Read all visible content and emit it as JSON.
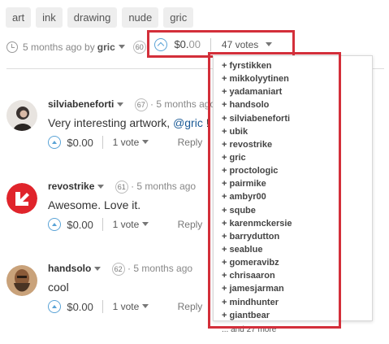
{
  "tags": [
    "art",
    "ink",
    "drawing",
    "nude",
    "gric"
  ],
  "post_meta": {
    "time": "5 months ago by",
    "author": "gric",
    "reputation": "60",
    "payout_main": "$0.",
    "payout_cents": "00",
    "votes": "47 votes"
  },
  "voters": {
    "items": [
      "+ fyrstikken",
      "+ mikkolyytinen",
      "+ yadamaniart",
      "+ handsolo",
      "+ silviabeneforti",
      "+ ubik",
      "+ revostrike",
      "+ gric",
      "+ proctologic",
      "+ pairmike",
      "+ ambyr00",
      "+ sqube",
      "+ karenmckersie",
      "+ barrydutton",
      "+ seablue",
      "+ gomeravibz",
      "+ chrisaaron",
      "+ jamesjarman",
      "+ mindhunter",
      "+ giantbear"
    ],
    "more": "... and 27 more"
  },
  "comments": [
    {
      "user": "silviabeneforti",
      "reputation": "67",
      "time": "· 5 months ago",
      "body_pre": "Very interesting artwork, ",
      "mention": "@gric",
      "body_post": " ! ",
      "payout": "$0.00",
      "votes": "1 vote",
      "reply": "Reply"
    },
    {
      "user": "revostrike",
      "reputation": "61",
      "time": "· 5 months ago",
      "body": "Awesome. Love it.",
      "payout": "$0.00",
      "votes": "1 vote",
      "reply": "Reply"
    },
    {
      "user": "handsolo",
      "reputation": "62",
      "time": "· 5 months ago",
      "body": "cool",
      "payout": "$0.00",
      "votes": "1 vote",
      "reply": "Reply"
    }
  ],
  "colors": {
    "highlight": "#d32f3a",
    "upvote": "#5aa3d6",
    "mention": "#1a5a96",
    "revostrike_avatar": "#e0242b"
  }
}
